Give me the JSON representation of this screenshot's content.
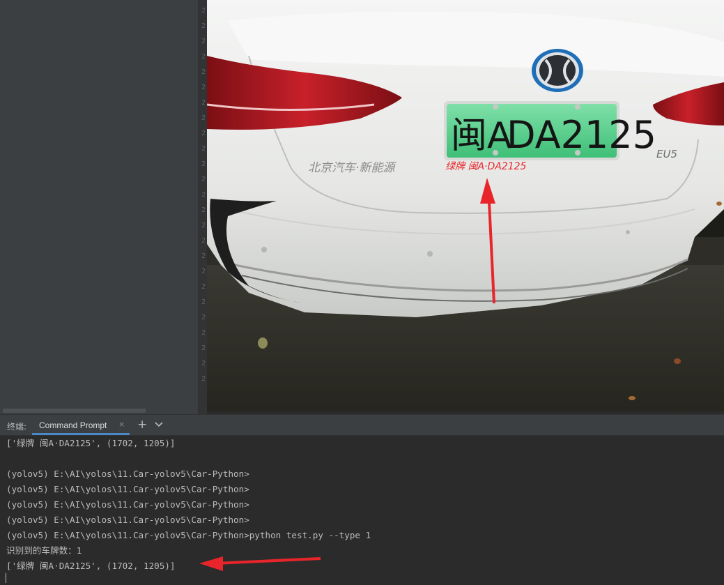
{
  "gutter": {
    "line_numbers": [
      "2",
      "2",
      "2",
      "2",
      "2",
      "2",
      "2",
      "2",
      "2",
      "2",
      "2",
      "2",
      "2",
      "2",
      "2",
      "2",
      "2",
      "2",
      "2",
      "2",
      "2",
      "2",
      "2",
      "2",
      "2"
    ]
  },
  "photo": {
    "plate_text": "闽A·DA2125",
    "plate_main": "DA2125",
    "plate_prefix": "闽A",
    "detection_label": "绿牌 闽A·DA2125",
    "car_badge_text": "北京汽车·新能源",
    "model_text": "EU5"
  },
  "terminal": {
    "title": "终端:",
    "tab_label": "Command Prompt",
    "tab_close": "×",
    "add_label": "+",
    "lines": [
      "['绿牌 闽A·DA2125', (1702, 1205)]",
      "",
      "(yolov5) E:\\AI\\yolos\\11.Car-yolov5\\Car-Python>",
      "(yolov5) E:\\AI\\yolos\\11.Car-yolov5\\Car-Python>",
      "(yolov5) E:\\AI\\yolos\\11.Car-yolov5\\Car-Python>",
      "(yolov5) E:\\AI\\yolos\\11.Car-yolov5\\Car-Python>",
      "(yolov5) E:\\AI\\yolos\\11.Car-yolov5\\Car-Python>python test.py --type 1",
      "识别到的车牌数：1",
      "['绿牌 闽A·DA2125', (1702, 1205)]"
    ]
  },
  "colors": {
    "sidebar": "#3c3f41",
    "editor": "#2b2b2b",
    "terminal_text": "#bbbbbb",
    "accent_tab": "#4a88c7",
    "annotation_red": "#e8252b",
    "plate_green": "#4fd08a"
  }
}
